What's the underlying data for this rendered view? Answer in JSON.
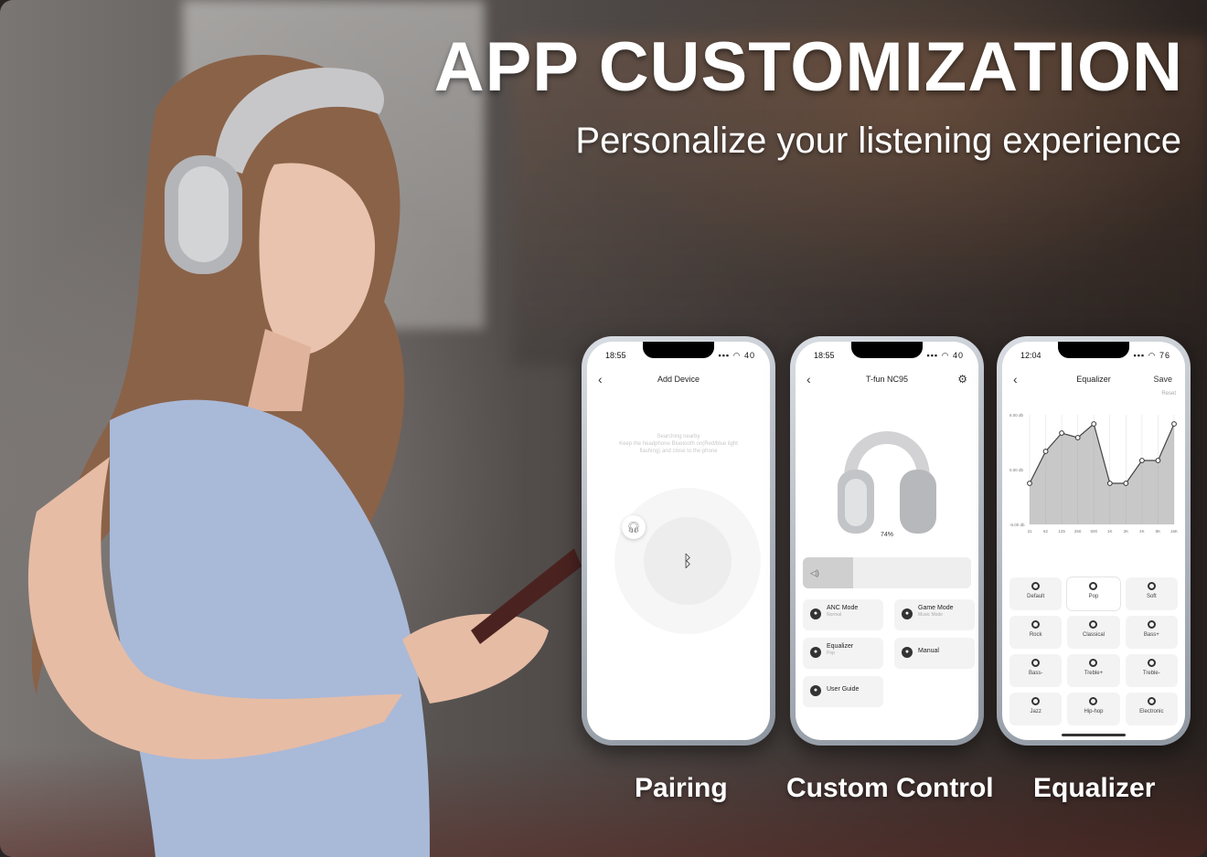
{
  "title": "APP CUSTOMIZATION",
  "subtitle": "Personalize your listening experience",
  "captions": [
    "Pairing",
    "Custom Control",
    "Equalizer"
  ],
  "phone1": {
    "time": "18:55",
    "battery": "40",
    "nav_title": "Add Device",
    "hint_line1": "Searching nearby",
    "hint_line2": "Keep the headphone Bluetooth on(Red/blue light",
    "hint_line3": "flashing) and close to the phone",
    "icons": {
      "back": "back-arrow-icon",
      "bluetooth": "bluetooth-icon",
      "device": "headphone-icon"
    }
  },
  "phone2": {
    "time": "18:55",
    "battery": "40",
    "nav_title": "T-fun NC95",
    "battery_level": "74%",
    "volume_level": 0.3,
    "controls": [
      {
        "label": "ANC Mode",
        "sub": "Normal"
      },
      {
        "label": "Game Mode",
        "sub": "Music Mode"
      },
      {
        "label": "Equalizer",
        "sub": "Pop"
      },
      {
        "label": "Manual",
        "sub": ""
      },
      {
        "label": "User Guide",
        "sub": ""
      }
    ],
    "icons": {
      "back": "back-arrow-icon",
      "settings": "gear-icon",
      "volume": "speaker-icon"
    }
  },
  "phone3": {
    "time": "12:04",
    "battery": "76",
    "nav_title": "Equalizer",
    "save_label": "Save",
    "reset_label": "Reset",
    "presets": [
      "Default",
      "Pop",
      "Soft",
      "Rock",
      "Classical",
      "Bass+",
      "Bass-",
      "Treble+",
      "Treble-",
      "Jazz",
      "Hip-hop",
      "Electronic"
    ],
    "selected_preset": "Pop",
    "icons": {
      "back": "back-arrow-icon"
    }
  },
  "chart_data": {
    "type": "line",
    "x": [
      "31",
      "62",
      "125",
      "250",
      "500",
      "1K",
      "2K",
      "4K",
      "8K",
      "16K"
    ],
    "series": [
      {
        "values": [
          -1.5,
          2,
          4,
          3.5,
          5,
          -1.5,
          -1.5,
          1,
          1,
          5
        ]
      }
    ],
    "ylim": [
      -6,
      6
    ],
    "y_ticks": [
      "6.00 db",
      "0.00 db",
      "-6.00 db"
    ],
    "grid": true
  }
}
